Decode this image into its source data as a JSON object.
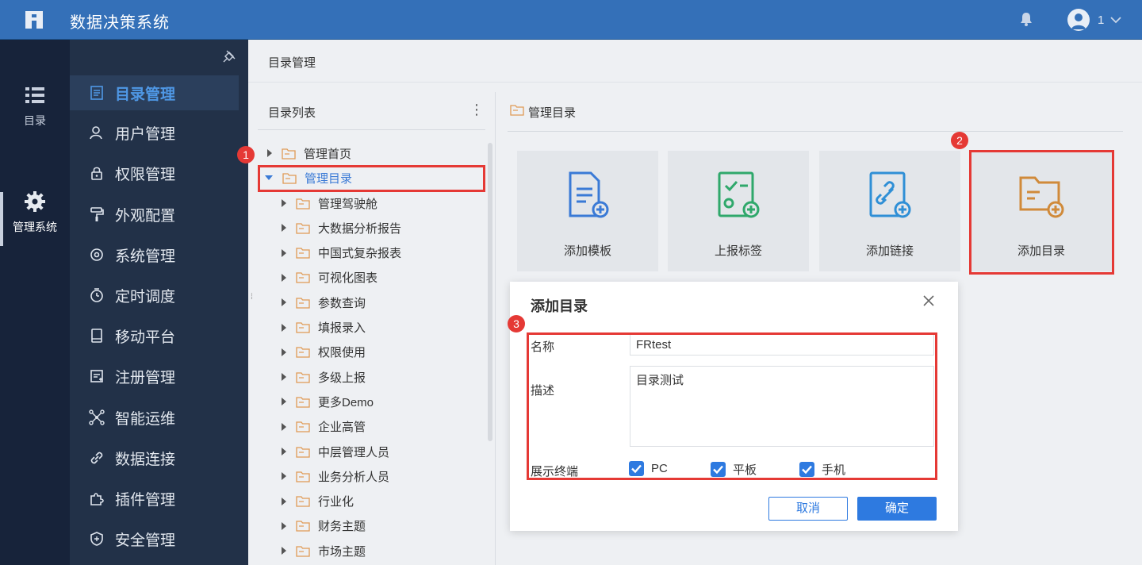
{
  "app": {
    "title": "数据决策系统",
    "user_name": "1"
  },
  "rail": {
    "items": [
      {
        "label": "目录"
      },
      {
        "label": "管理系统"
      }
    ]
  },
  "sidebar": {
    "items": [
      {
        "label": "目录管理"
      },
      {
        "label": "用户管理"
      },
      {
        "label": "权限管理"
      },
      {
        "label": "外观配置"
      },
      {
        "label": "系统管理"
      },
      {
        "label": "定时调度"
      },
      {
        "label": "移动平台"
      },
      {
        "label": "注册管理"
      },
      {
        "label": "智能运维"
      },
      {
        "label": "数据连接"
      },
      {
        "label": "插件管理"
      },
      {
        "label": "安全管理"
      }
    ]
  },
  "breadcrumb": "目录管理",
  "dir_list": {
    "title": "目录列表",
    "root": [
      {
        "label": "管理首页"
      },
      {
        "label": "管理目录"
      }
    ],
    "children": [
      {
        "label": "管理驾驶舱"
      },
      {
        "label": "大数据分析报告"
      },
      {
        "label": "中国式复杂报表"
      },
      {
        "label": "可视化图表"
      },
      {
        "label": "参数查询"
      },
      {
        "label": "填报录入"
      },
      {
        "label": "权限使用"
      },
      {
        "label": "多级上报"
      },
      {
        "label": "更多Demo"
      },
      {
        "label": "企业高管"
      },
      {
        "label": "中层管理人员"
      },
      {
        "label": "业务分析人员"
      },
      {
        "label": "行业化"
      },
      {
        "label": "财务主题"
      },
      {
        "label": "市场主题"
      }
    ]
  },
  "right_panel": {
    "title": "管理目录",
    "cards": [
      {
        "label": "添加模板",
        "color": "#3a7ad6"
      },
      {
        "label": "上报标签",
        "color": "#2fa86b"
      },
      {
        "label": "添加链接",
        "color": "#2f8fd6"
      },
      {
        "label": "添加目录",
        "color": "#d08a3a"
      }
    ]
  },
  "annotations": {
    "badge1": "1",
    "badge2": "2",
    "badge3": "3"
  },
  "dialog": {
    "title": "添加目录",
    "name_label": "名称",
    "name_value": "FRtest",
    "desc_label": "描述",
    "desc_value": "目录测试",
    "terminal_label": "展示终端",
    "terminals": [
      {
        "label": "PC",
        "checked": true
      },
      {
        "label": "平板",
        "checked": true
      },
      {
        "label": "手机",
        "checked": true
      }
    ],
    "cancel_label": "取消",
    "ok_label": "确定"
  },
  "colors": {
    "topbar": "#3470b8",
    "rail": "#17233a",
    "sidebar": "#223148",
    "accent": "#2e7ae0",
    "highlight": "#e53935"
  }
}
